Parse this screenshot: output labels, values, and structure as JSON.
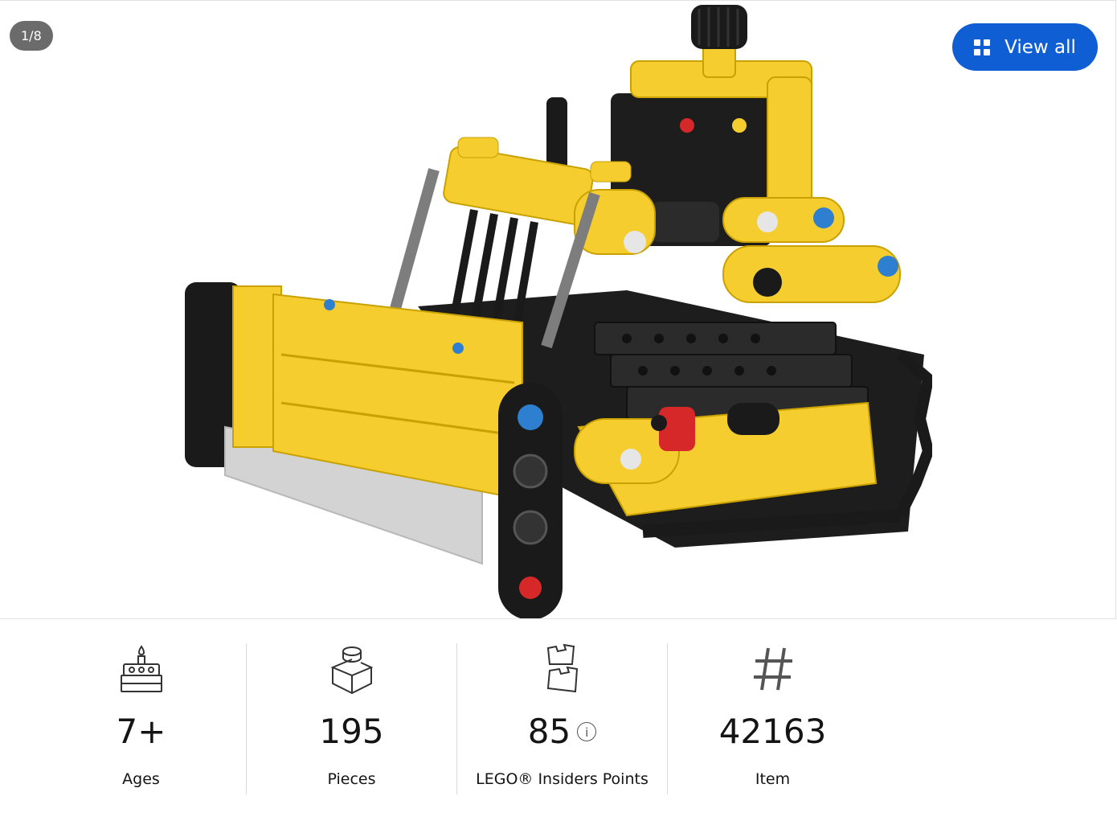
{
  "gallery": {
    "counter": "1/8",
    "view_all_label": "View all",
    "view_all_icon": "grid-icon",
    "image_alt": "LEGO Technic yellow bulldozer model"
  },
  "specs": [
    {
      "icon": "birthday-cake-icon",
      "value": "7+",
      "label": "Ages"
    },
    {
      "icon": "brick-icon",
      "value": "195",
      "label": "Pieces"
    },
    {
      "icon": "insiders-points-icon",
      "value": "85",
      "label": "LEGO® Insiders Points",
      "info_icon": "info-icon"
    },
    {
      "icon": "hash-icon",
      "value": "42163",
      "label": "Item"
    }
  ],
  "colors": {
    "accent": "#0f5ed3",
    "lego_yellow": "#f5cd2f",
    "counter_bg": "#6b6b6b"
  }
}
